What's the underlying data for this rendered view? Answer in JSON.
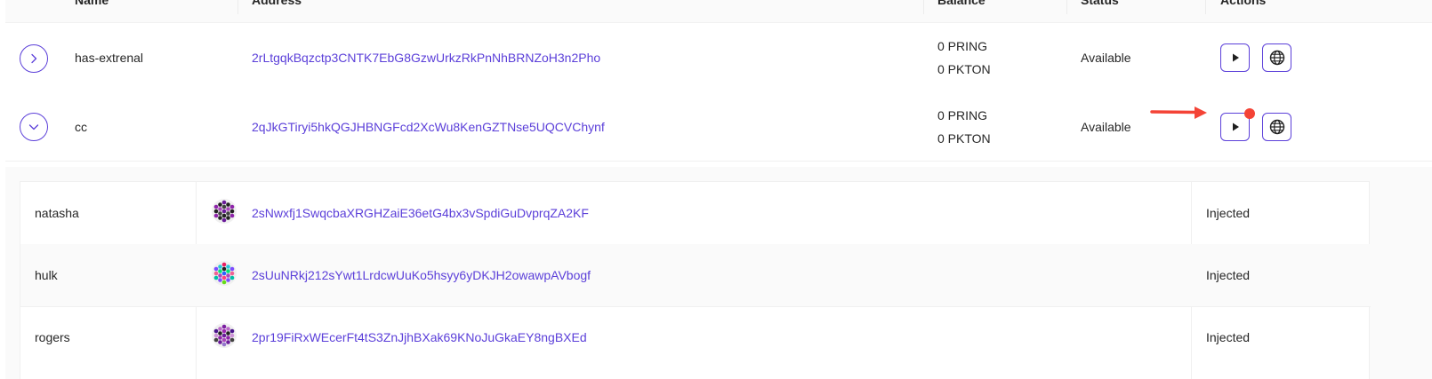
{
  "table": {
    "headers": {
      "name": "Name",
      "address": "Address",
      "balance": "Balance",
      "status": "Status",
      "actions": "Actions"
    },
    "rows": [
      {
        "name": "has-extrenal",
        "address": "2rLtgqkBqzctp3CNTK7EbG8GzwUrkzRkPnNhBRNZoH3n2Pho",
        "balance_ring": "0 PRING",
        "balance_kton": "0 PKTON",
        "status": "Available",
        "expanded": false
      },
      {
        "name": "cc",
        "address": "2qJkGTiryi5hkQGJHBNGFcd2XcWu8KenGZTNse5UQCVChynf",
        "balance_ring": "0 PRING",
        "balance_kton": "0 PKTON",
        "status": "Available",
        "expanded": true
      }
    ]
  },
  "members": [
    {
      "name": "natasha",
      "address": "2sNwxfj1SwqcbaXRGHZaiE36etG4bx3vSpdiGuDvprqZA2KF",
      "status": "Injected"
    },
    {
      "name": "hulk",
      "address": "2sUuNRkj212sYwt1LrdcwUuKo5hsyy6yDKJH2owawpAVbogf",
      "status": "Injected"
    },
    {
      "name": "rogers",
      "address": "2pr19FiRxWEcerFt4tS3ZnJjhBXak69KNoJuGkaEY8ngBXEd",
      "status": "Injected"
    }
  ],
  "colors": {
    "accent": "#5b3fd9",
    "annotation": "#f44336"
  },
  "icons": {
    "expand": "chevron-right-icon",
    "collapse": "chevron-down-icon",
    "play": "play-icon",
    "globe": "globe-icon"
  }
}
